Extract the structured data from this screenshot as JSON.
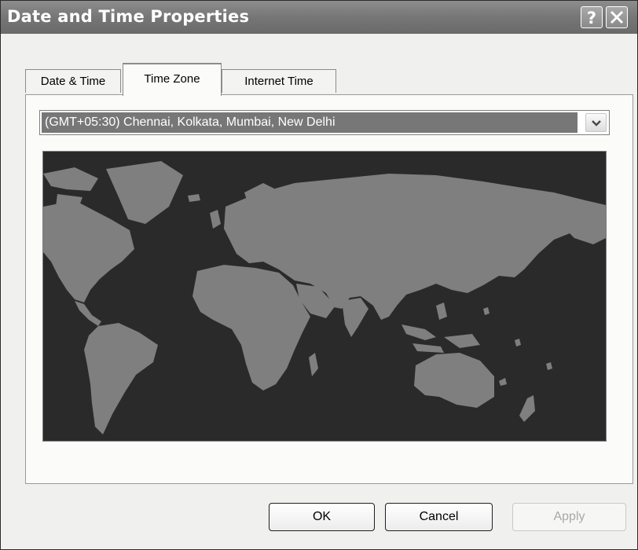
{
  "window": {
    "title": "Date and Time Properties",
    "help_glyph": "?",
    "close_glyph": "X"
  },
  "tabs": [
    {
      "label": "Date & Time"
    },
    {
      "label": "Time Zone",
      "selected": true
    },
    {
      "label": "Internet Time"
    }
  ],
  "timezone": {
    "selected": "(GMT+05:30) Chennai, Kolkata, Mumbai, New Delhi",
    "arrow_glyph": "chevron-down-icon"
  },
  "map": {
    "ocean_color": "#2a2a2a",
    "land_color": "#7f7f7f"
  },
  "buttons": {
    "ok": "OK",
    "cancel": "Cancel",
    "apply": "Apply",
    "apply_enabled": false
  }
}
